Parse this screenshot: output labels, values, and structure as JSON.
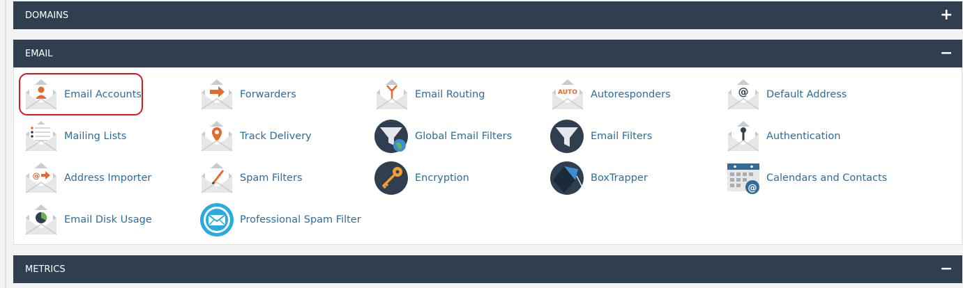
{
  "sections": {
    "domains": {
      "title": "DOMAINS",
      "toggle": "+"
    },
    "email": {
      "title": "EMAIL",
      "toggle": "−"
    },
    "metrics": {
      "title": "METRICS",
      "toggle": "−"
    }
  },
  "email_items": [
    {
      "label": "Email Accounts",
      "icon": "email-accounts-icon"
    },
    {
      "label": "Forwarders",
      "icon": "forwarders-icon"
    },
    {
      "label": "Email Routing",
      "icon": "email-routing-icon"
    },
    {
      "label": "Autoresponders",
      "icon": "autoresponders-icon",
      "icon_text": "AUTO"
    },
    {
      "label": "Default Address",
      "icon": "default-address-icon",
      "icon_text": "@"
    },
    {
      "label": "Mailing Lists",
      "icon": "mailing-lists-icon"
    },
    {
      "label": "Track Delivery",
      "icon": "track-delivery-icon"
    },
    {
      "label": "Global Email Filters",
      "icon": "global-email-filters-icon"
    },
    {
      "label": "Email Filters",
      "icon": "email-filters-icon"
    },
    {
      "label": "Authentication",
      "icon": "authentication-icon"
    },
    {
      "label": "Address Importer",
      "icon": "address-importer-icon",
      "icon_text": "@"
    },
    {
      "label": "Spam Filters",
      "icon": "spam-filters-icon"
    },
    {
      "label": "Encryption",
      "icon": "encryption-icon"
    },
    {
      "label": "BoxTrapper",
      "icon": "boxtrapper-icon"
    },
    {
      "label": "Calendars and Contacts",
      "icon": "calendars-contacts-icon",
      "icon_text": "@"
    },
    {
      "label": "Email Disk Usage",
      "icon": "email-disk-usage-icon"
    },
    {
      "label": "Professional Spam Filter",
      "icon": "professional-spam-filter-icon"
    }
  ],
  "colors": {
    "header_bg": "#2f3f4f",
    "link": "#2f6c9c",
    "accent_orange": "#e8692c",
    "highlight_red": "#d9161d"
  }
}
